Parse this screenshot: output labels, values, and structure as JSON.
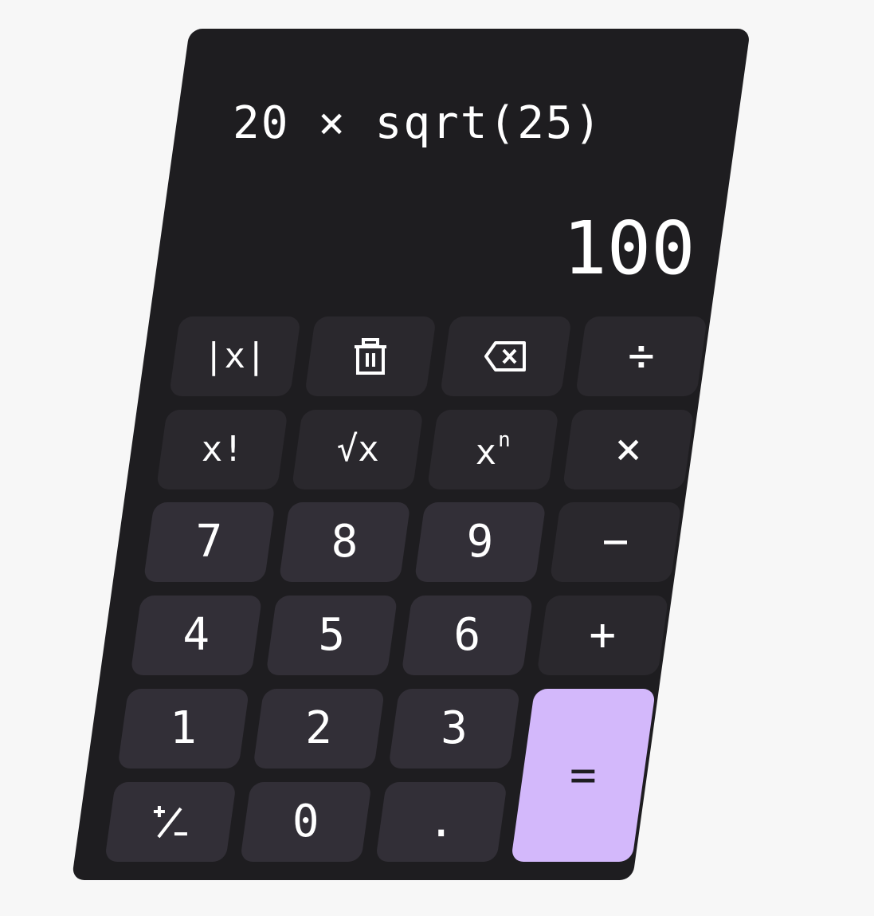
{
  "display": {
    "expression": "20 × sqrt(25)",
    "result": "100"
  },
  "keys": {
    "abs": "|x|",
    "clear_icon": "trash-icon",
    "backspace_icon": "backspace-icon",
    "divide": "÷",
    "factorial": "x!",
    "sqrt": "√x",
    "power_base": "x",
    "power_exp": "n",
    "multiply": "×",
    "seven": "7",
    "eight": "8",
    "nine": "9",
    "minus": "−",
    "four": "4",
    "five": "5",
    "six": "6",
    "plus": "+",
    "one": "1",
    "two": "2",
    "three": "3",
    "equals": "=",
    "plus_minus": "⁺∕₋",
    "zero": "0",
    "decimal": "."
  },
  "colors": {
    "body": "#1e1d20",
    "function_key": "#2a282d",
    "number_key": "#322f37",
    "equals_key": "#d3b8fb",
    "text": "#ffffff",
    "background": "#f7f7f7"
  }
}
